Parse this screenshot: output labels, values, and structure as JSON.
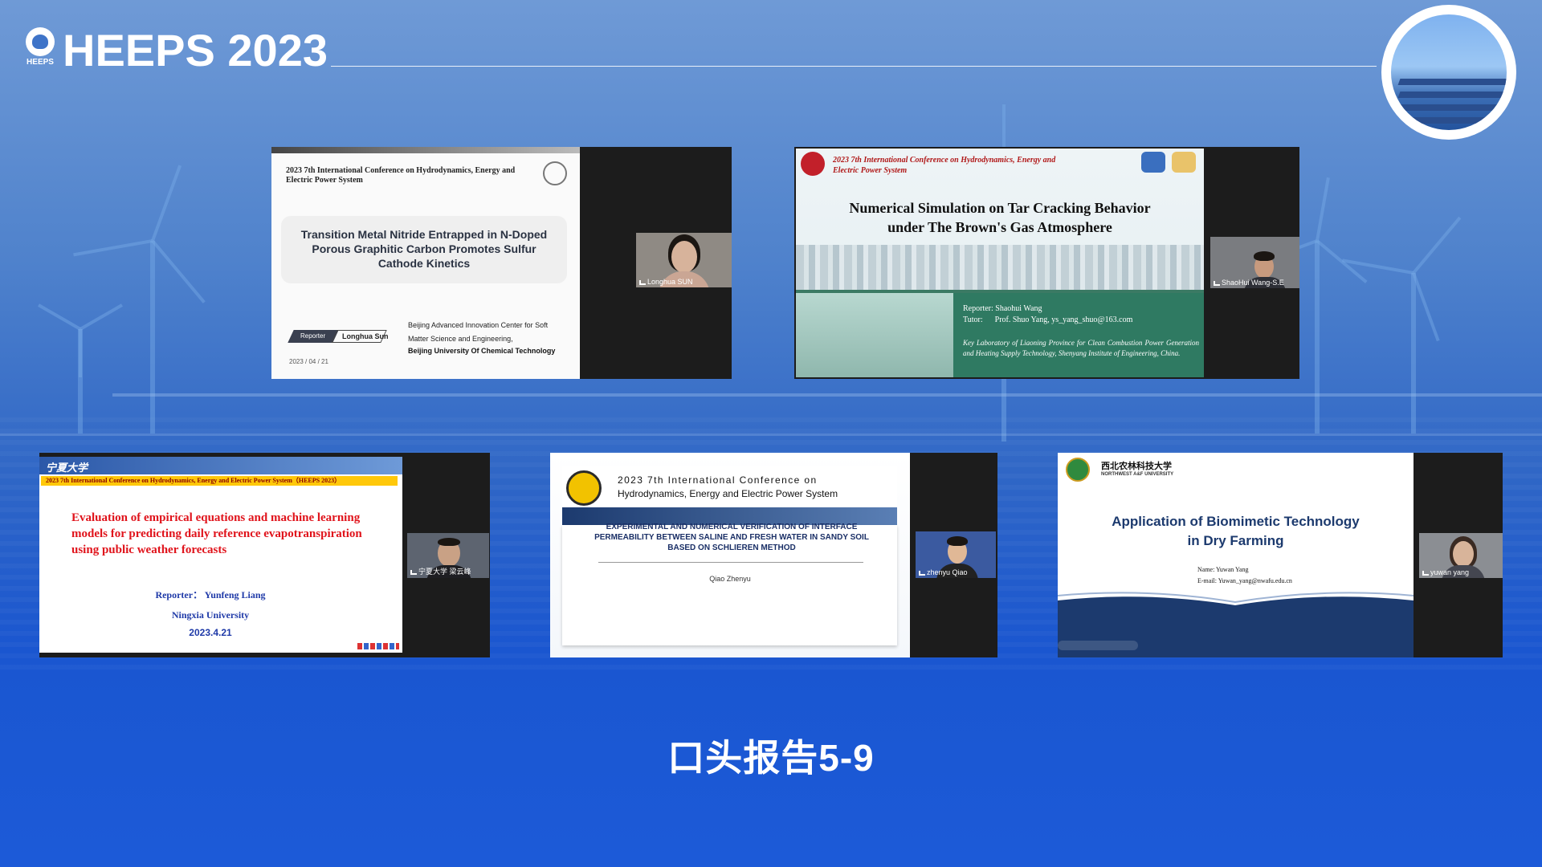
{
  "header": {
    "title": "HEEPS 2023",
    "logo_text": "HEEPS"
  },
  "tiles": {
    "t1": {
      "conf": "2023 7th International Conference on Hydrodynamics, Energy and Electric Power System",
      "title": "Transition Metal Nitride Entrapped in N-Doped Porous Graphitic Carbon Promotes Sulfur Cathode Kinetics",
      "reporter_label": "Reporter",
      "reporter_name": "Longhua Sun",
      "affil1": "Beijing Advanced Innovation Center for Soft Matter Science and Engineering,",
      "affil2": "Beijing University Of Chemical Technology",
      "date": "2023 / 04 / 21",
      "cam_name": "Longhua SUN"
    },
    "t2": {
      "conf": "2023 7th International Conference on Hydrodynamics, Energy and Electric Power System",
      "title_l1": "Numerical Simulation on Tar Cracking Behavior",
      "title_l2": "under The Brown's Gas Atmosphere",
      "reporter": "Reporter:  Shaohui Wang",
      "tutor": "Tutor:      Prof. Shuo Yang, ys_yang_shuo@163.com",
      "lab": "Key Laboratory of Liaoning Province for Clean Combustion Power Generation and Heating Supply Technology, Shenyang Institute of Engineering, China.",
      "cam_name": "ShaoHui Wang-S.E"
    },
    "t3": {
      "uni_logo": "宁夏大学",
      "conf": "2023 7th International Conference on Hydrodynamics, Energy and Electric Power System（HEEPS 2023）",
      "title": "Evaluation of empirical equations and machine learning models for predicting daily reference evapotranspiration using public weather forecasts",
      "reporter": "Reporter： Yunfeng Liang",
      "uni": "Ningxia University",
      "date": "2023.4.21",
      "cam_name": "宁夏大学 梁云峰"
    },
    "t4": {
      "conf_l1": "2023  7th  International  Conference  on",
      "conf_l2": "Hydrodynamics, Energy and Electric Power System",
      "title": "EXPERIMENTAL AND NUMERICAL VERIFICATION OF INTERFACE PERMEABILITY BETWEEN SALINE AND FRESH WATER IN SANDY SOIL BASED ON SCHLIEREN METHOD",
      "author": "Qiao Zhenyu",
      "cam_name": "zhenyu Qiao"
    },
    "t5": {
      "uni_name": "西北农林科技大学",
      "uni_en": "NORTHWEST A&F UNIVERSITY",
      "title_l1": "Application of Biomimetic Technology",
      "title_l2": "in Dry Farming",
      "name": "Name: Yuwan Yang",
      "email": "E-mail: Yuwan_yang@nwafu.edu.cn",
      "cam_name": "yuwan yang"
    }
  },
  "footer": {
    "caption": "口头报告5-9"
  },
  "colors": {
    "bg_top": "#6f9ad6",
    "bg_bottom": "#1c5ad8",
    "accent_red": "#e0131b",
    "accent_blue": "#1f3aa8",
    "navy": "#1c3a6e"
  }
}
